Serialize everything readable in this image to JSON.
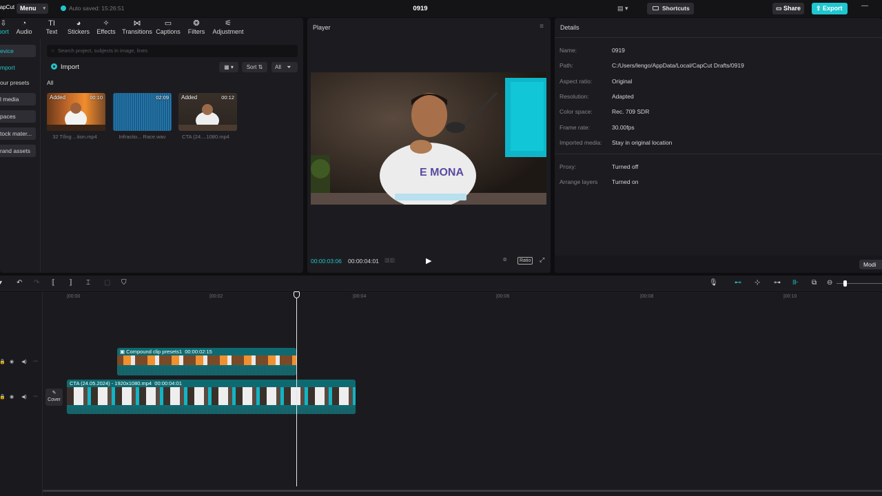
{
  "app": {
    "logo": "CapCut",
    "menu_label": "Menu",
    "autosave": "Auto saved: 15:26:51",
    "project_title": "0919",
    "shortcuts_label": "Shortcuts",
    "share_label": "Share",
    "export_label": "Export",
    "accent_color": "#22c5c9"
  },
  "tabs": [
    {
      "label": "port",
      "icon": "import-icon"
    },
    {
      "label": "Audio",
      "icon": "audio-icon"
    },
    {
      "label": "Text",
      "icon": "text-icon"
    },
    {
      "label": "Stickers",
      "icon": "sticker-icon"
    },
    {
      "label": "Effects",
      "icon": "effects-icon"
    },
    {
      "label": "Transitions",
      "icon": "transitions-icon"
    },
    {
      "label": "Captions",
      "icon": "captions-icon"
    },
    {
      "label": "Filters",
      "icon": "filters-icon"
    },
    {
      "label": "Adjustment",
      "icon": "adjustment-icon"
    }
  ],
  "sidebar": [
    {
      "label": "evice"
    },
    {
      "label": "mport"
    },
    {
      "label": "our presets"
    },
    {
      "label": "l media"
    },
    {
      "label": "paces"
    },
    {
      "label": "tock mater..."
    },
    {
      "label": "rand assets"
    }
  ],
  "media": {
    "search_placeholder": "Search project, subjects in image, lines",
    "import_label": "Import",
    "sort_label": "Sort",
    "all_filter_label": "All",
    "section_label": "All",
    "items": [
      {
        "name": "32 Tổng ...tion.mp4",
        "duration": "00:10",
        "badge": "Added"
      },
      {
        "name": "Infractio... Race.wav",
        "duration": "02:09",
        "badge": ""
      },
      {
        "name": "CTA (24....1080.mp4",
        "duration": "00:12",
        "badge": "Added"
      }
    ]
  },
  "player": {
    "title": "Player",
    "current_time": "00:00:03:06",
    "total_time": "00:00:04:01",
    "ratio_label": "Ratio",
    "video_text": "E MONA"
  },
  "details": {
    "title": "Details",
    "rows": [
      {
        "key": "Name:",
        "value": "0919"
      },
      {
        "key": "Path:",
        "value": "C:/Users/lengo/AppData/Local/CapCut Drafts/0919"
      },
      {
        "key": "Aspect ratio:",
        "value": "Original"
      },
      {
        "key": "Resolution:",
        "value": "Adapted"
      },
      {
        "key": "Color space:",
        "value": "Rec. 709 SDR"
      },
      {
        "key": "Frame rate:",
        "value": "30.00fps"
      },
      {
        "key": "Imported media:",
        "value": "Stay in original location"
      },
      {
        "key": "Proxy:",
        "value": "Turned off"
      },
      {
        "key": "Arrange layers",
        "value": "Turned on"
      }
    ],
    "modify_label": "Modi"
  },
  "timeline": {
    "ruler": [
      "|00:00",
      "|00:02",
      "|00:04",
      "|00:06",
      "|00:08",
      "|00:10"
    ],
    "compound_clip": {
      "label": "Compound clip presets1",
      "duration": "00:00:02:15"
    },
    "main_clip": {
      "label": "CTA (24.05.2024) - 1920x1080.mp4",
      "duration": "00:00:04:01"
    },
    "cover_label": "Cover"
  }
}
